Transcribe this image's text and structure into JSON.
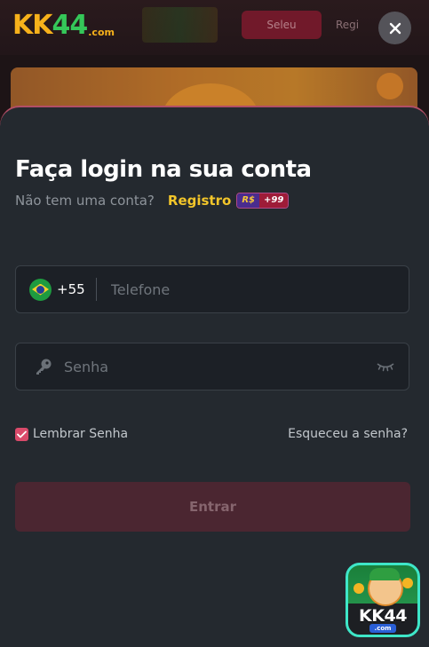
{
  "background": {
    "logo": {
      "part1": "KK",
      "part2": "44",
      "suffix": ".com"
    },
    "header_btn_a": "Seleu",
    "header_btn_b": "Regi"
  },
  "modal": {
    "title": "Faça login na sua conta",
    "no_account_text": "Não tem uma conta?",
    "register_link": "Registro",
    "bonus_badge": {
      "currency": "R$",
      "amount": "+99"
    },
    "phone": {
      "country_code": "+55",
      "placeholder": "Telefone",
      "value": ""
    },
    "password": {
      "placeholder": "Senha",
      "value": ""
    },
    "remember_label": "Lembrar Senha",
    "remember_checked": true,
    "forgot_link": "Esqueceu a senha?",
    "submit_label": "Entrar"
  },
  "app_badge": {
    "label": "KK44",
    "suffix": ".com"
  },
  "colors": {
    "accent": "#d94a6a",
    "register": "#f2c52a",
    "modal_bg": "#24292f",
    "submit_bg": "#4b2631"
  },
  "icons": [
    "close-icon",
    "brazil-flag-icon",
    "key-icon",
    "eye-closed-icon",
    "check-icon"
  ]
}
